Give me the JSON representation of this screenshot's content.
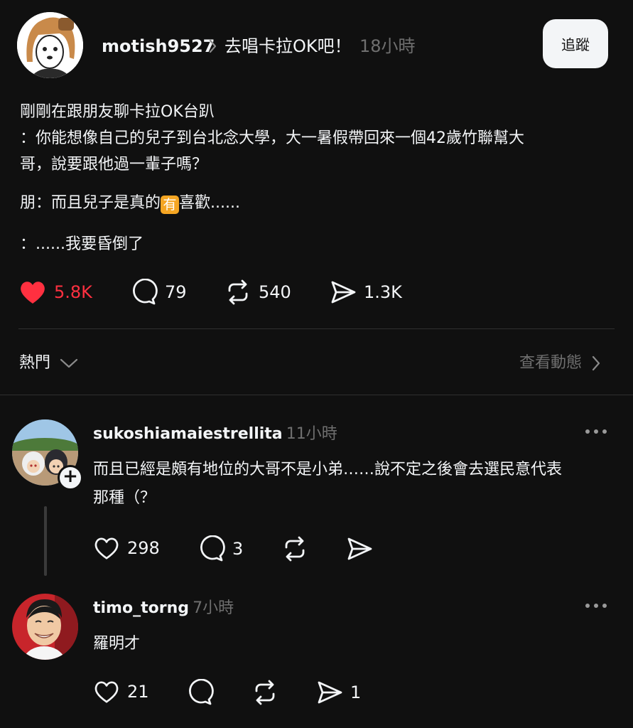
{
  "post": {
    "username": "motish9527",
    "topic": "去唱卡拉OK吧！",
    "time": "18小時",
    "follow_label": "追蹤",
    "lines": [
      "剛剛在跟朋友聊卡拉OK台趴",
      "：你能想像自己的兒子到台北念大學，大一暑假帶回來一個42歲竹聯幫大",
      "哥，說要跟他過一輩子嗎？"
    ],
    "line_friend_pre": "朋：而且兒子是真的",
    "emoji_char": "有",
    "line_friend_post": "喜歡......",
    "line_last": "：......我要昏倒了",
    "stats": {
      "likes": "5.8K",
      "comments": "79",
      "reposts": "540",
      "shares": "1.3K"
    },
    "like_color": "#ff3040"
  },
  "sort": {
    "label": "熱門",
    "activity_label": "查看動態"
  },
  "comments": [
    {
      "username": "sukoshiamaiestrellita",
      "time": "11小時",
      "text_line1": "而且已經是頗有地位的大哥不是小弟……說不定之後會去選民意代表",
      "text_line2": "那種（？",
      "likes": "298",
      "replies": "3"
    },
    {
      "username": "timo_torng",
      "time": "7小時",
      "text": "羅明才",
      "likes": "21",
      "shares": "1"
    }
  ]
}
